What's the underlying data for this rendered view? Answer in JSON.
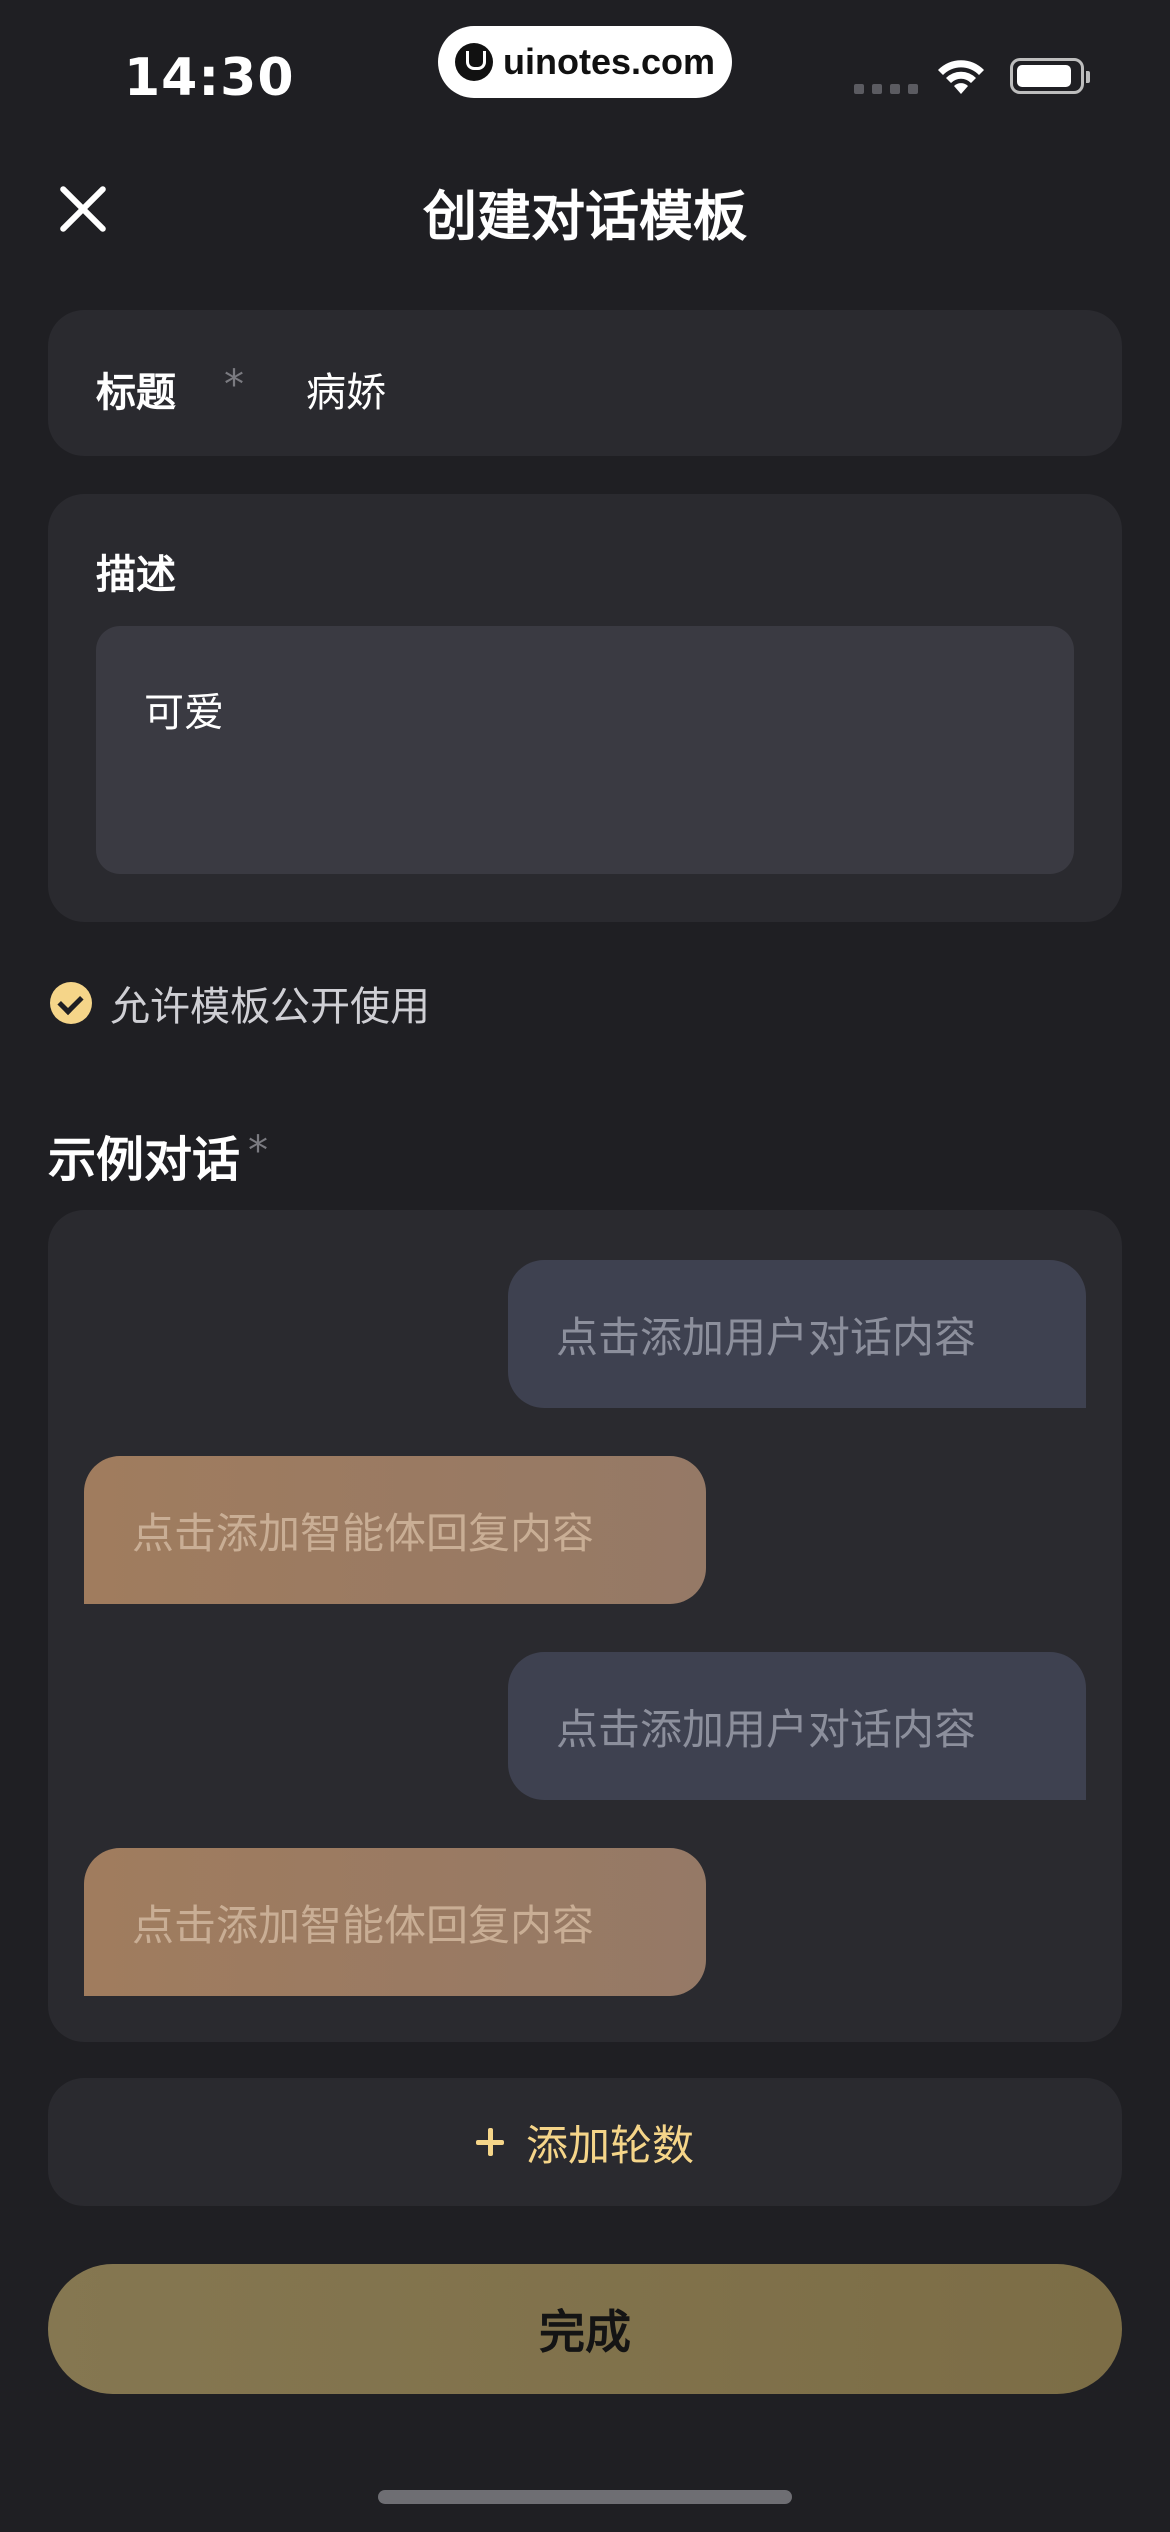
{
  "status_bar": {
    "time": "14:30",
    "watermark": "uinotes.com"
  },
  "header": {
    "title": "创建对话模板",
    "close_icon": "close-icon"
  },
  "form": {
    "title_label": "标题",
    "title_value": "病娇",
    "required_mark": "*",
    "description_label": "描述",
    "description_value": "可爱",
    "public_checkbox_label": "允许模板公开使用",
    "public_checked": true
  },
  "examples": {
    "section_title": "示例对话",
    "required_mark": "*",
    "bubbles": [
      {
        "role": "user",
        "placeholder": "点击添加用户对话内容"
      },
      {
        "role": "agent",
        "placeholder": "点击添加智能体回复内容"
      },
      {
        "role": "user",
        "placeholder": "点击添加用户对话内容"
      },
      {
        "role": "agent",
        "placeholder": "点击添加智能体回复内容"
      }
    ]
  },
  "actions": {
    "add_rounds_label": "添加轮数",
    "done_label": "完成"
  },
  "colors": {
    "background": "#1f1f23",
    "card": "#2a2a2f",
    "accent": "#f5d589",
    "user_bubble": "#3e4150",
    "agent_bubble": "#a07c5e",
    "done_button": "#857751"
  }
}
